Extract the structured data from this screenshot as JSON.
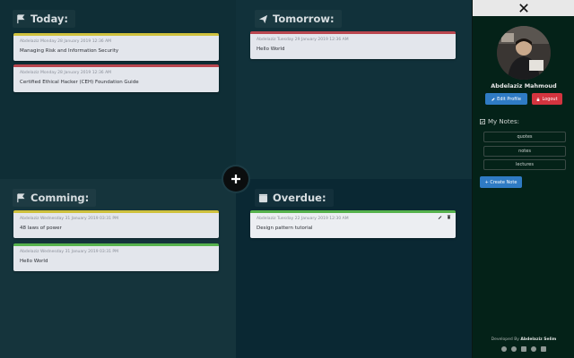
{
  "sections": {
    "today": {
      "title": "Today:"
    },
    "tomorrow": {
      "title": "Tomorrow:"
    },
    "coming": {
      "title": "Comming:"
    },
    "overdue": {
      "title": "Overdue:"
    }
  },
  "cards": {
    "today": [
      {
        "date": "Abdelaziz Monday 28 January 2019 12:36 AM",
        "text": "Managing Risk and Information Security"
      },
      {
        "date": "Abdelaziz Monday 28 January 2019 12:36 AM",
        "text": "Certified Ethical Hacker (CEH) Foundation Guide"
      }
    ],
    "tomorrow": [
      {
        "date": "Abdelaziz Tuesday 29 January 2019 12:36 AM",
        "text": "Hello World"
      }
    ],
    "coming": [
      {
        "date": "Abdelaziz Wednesday 31 January 2019 03:31 PM",
        "text": "48 laws of power"
      },
      {
        "date": "Abdelaziz Wednesday 31 January 2019 03:31 PM",
        "text": "Hello World"
      }
    ],
    "overdue": [
      {
        "date": "Abdelaziz Tuesday 22 January 2019 12:30 AM",
        "text": "Design pattern tutorial"
      }
    ]
  },
  "sidebar": {
    "user_name": "Abdelaziz Mahmoud",
    "edit_profile": "Edit Profile",
    "logout": "Logout",
    "notes_heading": "My Notes:",
    "notes": [
      "quotes",
      "notes",
      "lectures"
    ],
    "create_note": "+ Create Note",
    "credit_prefix": "Developed By",
    "credit_name": "Abdelaziz Selim"
  },
  "colors": {
    "accent_blue": "#2f7bc4",
    "danger_red": "#d4343f",
    "card_yellow": "#cfc13d",
    "card_red": "#b9464f",
    "card_green": "#56b24d"
  },
  "icons": {
    "today": "flag-icon",
    "tomorrow": "paper-plane-icon",
    "coming": "flag-icon",
    "overdue": "archive-icon",
    "notes": "checkbox-icon"
  }
}
